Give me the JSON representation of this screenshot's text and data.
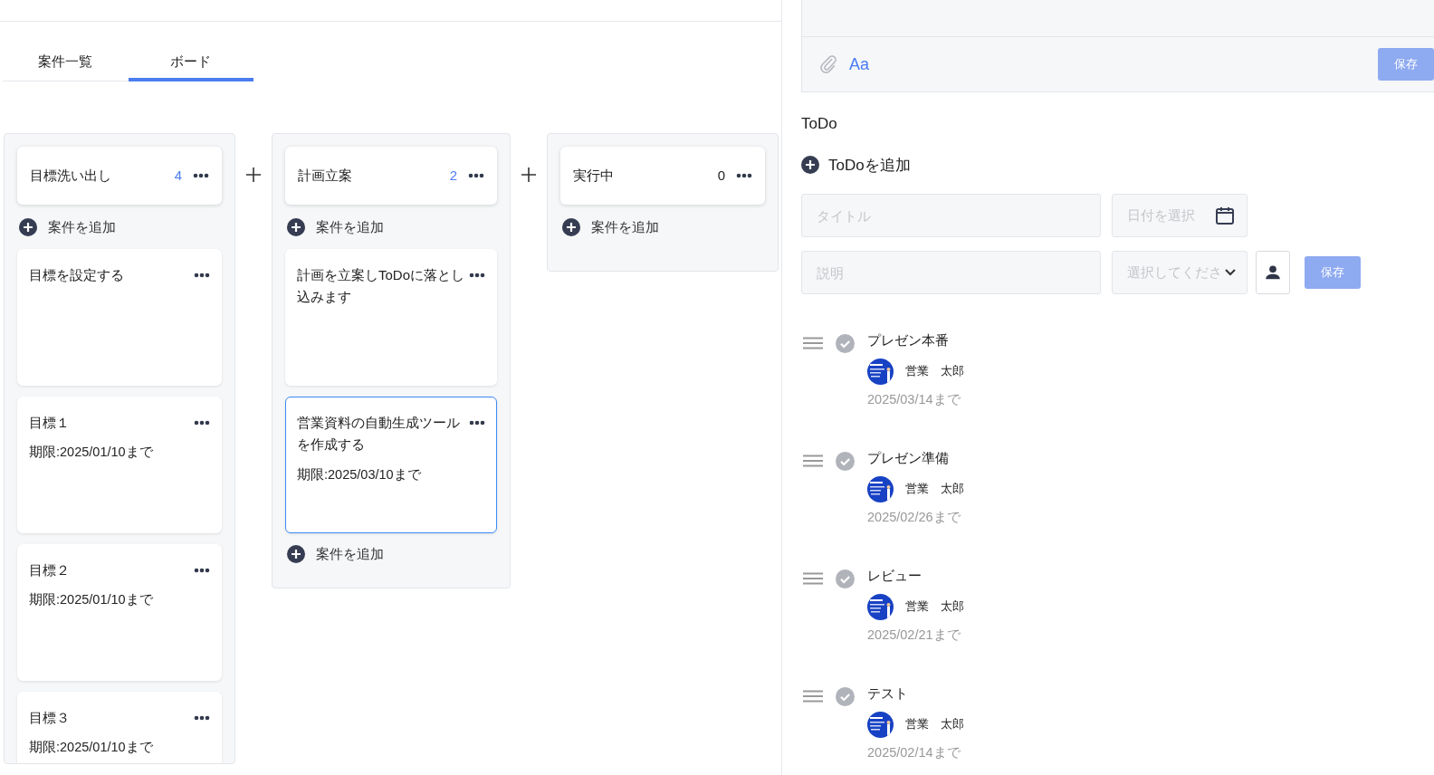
{
  "tabs": [
    {
      "label": "案件一覧",
      "selected": false
    },
    {
      "label": "ボード",
      "selected": true
    }
  ],
  "columns": [
    {
      "title": "目標洗い出し",
      "count": "4",
      "add_top": "案件を追加",
      "cards": [
        {
          "title": "目標を設定する",
          "selected": false
        },
        {
          "title": "目標１",
          "due": "期限:2025/01/10まで",
          "selected": false
        },
        {
          "title": "目標２",
          "due": "期限:2025/01/10まで",
          "selected": false
        },
        {
          "title": "目標３",
          "due": "期限:2025/01/10まで",
          "selected": false
        }
      ]
    },
    {
      "title": "計画立案",
      "count": "2",
      "add_top": "案件を追加",
      "add_bottom": "案件を追加",
      "cards": [
        {
          "title": "計画を立案しToDoに落とし込みます",
          "selected": false
        },
        {
          "title": "営業資料の自動生成ツールを作成する",
          "due": "期限:2025/03/10まで",
          "selected": true
        }
      ]
    },
    {
      "title": "実行中",
      "count": "0",
      "add_top": "案件を追加"
    }
  ],
  "editor": {
    "format_label": "Aa",
    "save": "保存"
  },
  "todo": {
    "heading": "ToDo",
    "add_label": "ToDoを追加",
    "form": {
      "title_placeholder": "タイトル",
      "date_placeholder": "日付を選択",
      "description_placeholder": "説明",
      "assignee_placeholder": "選択してくださ",
      "save": "保存"
    },
    "items": [
      {
        "title": "プレゼン本番",
        "assignee": "営業　太郎",
        "due": "2025/03/14まで",
        "done": false
      },
      {
        "title": "プレゼン準備",
        "assignee": "営業　太郎",
        "due": "2025/02/26まで",
        "done": false
      },
      {
        "title": "レビュー",
        "assignee": "営業　太郎",
        "due": "2025/02/21まで",
        "done": false
      },
      {
        "title": "テスト",
        "assignee": "営業　太郎",
        "due": "2025/02/14まで",
        "done": false
      }
    ]
  }
}
